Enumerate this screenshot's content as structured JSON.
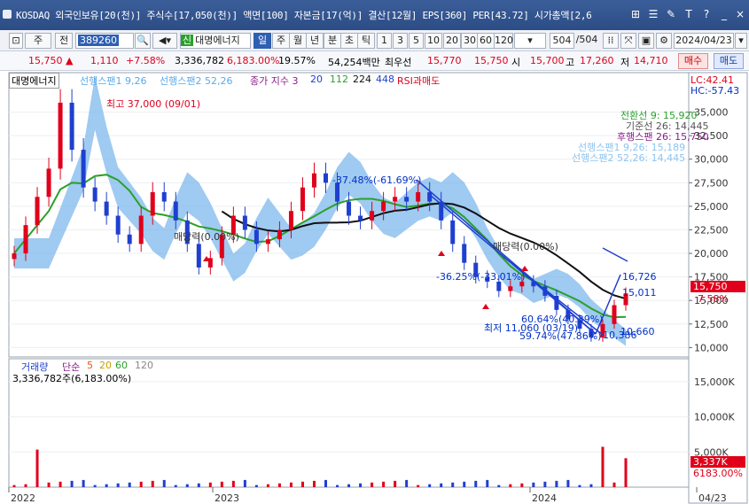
{
  "window": {
    "title": "KOSDAQ 외국인보유[20(천)] 주식수[17,050(천)] 액면[100] 자본금[17(억)] 결산[12월] EPS[360] PER[43.72] 시가총액[2,6",
    "buttons": [
      "⊞",
      "☰",
      "✎",
      "T",
      "?",
      "_",
      "×"
    ]
  },
  "toolbar": {
    "market": "주",
    "prev_label": "전",
    "code": "389260",
    "company": "대명에너지",
    "periods": [
      "일",
      "주",
      "월",
      "년",
      "분",
      "초",
      "틱"
    ],
    "selected_period": "일",
    "intervals": [
      "1",
      "3",
      "5",
      "10",
      "20",
      "30",
      "60",
      "120"
    ],
    "count": "504",
    "total": "/504",
    "date": "2024/04/23"
  },
  "quote": {
    "price": "15,750",
    "change_arrow": "▲",
    "change": "1,110",
    "change_pct": "+7.58%",
    "volume": "3,336,782",
    "volume_pct": "6,183.00%",
    "turnover": "19.57%",
    "amount": "54,254백만",
    "best_sell_label": "최우선",
    "best_sell": "15,770",
    "best_buy": "15,750",
    "open_label": "시",
    "open": "15,700",
    "high_label": "고",
    "high": "17,260",
    "low_label": "저",
    "low": "14,710",
    "buy_label": "매수",
    "sell_label": "매도"
  },
  "legend": {
    "name": "대명에너지",
    "span1": "선행스팬1 9,26",
    "span2": "선행스팬2 52,26",
    "close_index": "종가 지수 3",
    "ma_periods": [
      "20",
      "112",
      "224",
      "448"
    ],
    "rsi": "RSI과매도"
  },
  "ichimoku_labels": [
    "전환선 9: 15,920",
    "기준선 26: 14,445",
    "후행스팬 26: 15,750",
    "선행스팬1 9,26: 15,189",
    "선행스팬2 52,26: 14,445"
  ],
  "right_panel": {
    "lc": "LC:42.41",
    "hc": "HC:-57.43",
    "price_box": "15,750",
    "pct": "7.58%",
    "vol_box": "3,337K",
    "vol_pct": "6183.00%"
  },
  "annotations": {
    "high_note": "최고 37,000 (09/01)",
    "low_note": "최저 11,060 (03/19)",
    "drop1": "-37.48%(-61.69%)",
    "drop2": "-36.25%(-33.01%)",
    "line1": "60.64%(40.39%)",
    "line2": "59.74%(47.86%)",
    "v1": "16,726",
    "v2": "15,011",
    "v3": "10,660",
    "v4": "10,386",
    "bal1": "매당력(0.00%)",
    "bal2": "매당력(0.00%)"
  },
  "volume_panel": {
    "title": "거래량",
    "ma_label": "단순",
    "ma_periods": [
      "5",
      "20",
      "60",
      "120"
    ],
    "current": "3,336,782주(6,183.00%)"
  },
  "chart_data": {
    "type": "line",
    "price_axis": [
      "35,000",
      "32,500",
      "30,000",
      "27,500",
      "25,000",
      "22,500",
      "20,000",
      "17,500",
      "15,000",
      "12,500",
      "10,000"
    ],
    "volume_axis": [
      "15,000K",
      "10,000K",
      "5,000K"
    ],
    "x_labels": [
      "2022",
      "2023",
      "2024",
      "04/23"
    ],
    "ylim": [
      9000,
      37500
    ],
    "close_series": [
      20000,
      23000,
      26000,
      29000,
      36000,
      31000,
      27000,
      25500,
      24000,
      22000,
      21000,
      24000,
      26500,
      25500,
      23500,
      21000,
      18500,
      19500,
      22000,
      24000,
      22500,
      21000,
      21500,
      22500,
      24500,
      27000,
      28500,
      27500,
      25500,
      24000,
      23500,
      24500,
      25500,
      26000,
      25500,
      26500,
      25500,
      23500,
      21000,
      19000,
      17500,
      17000,
      16000,
      16500,
      17000,
      16500,
      15500,
      14000,
      13000,
      12000,
      11060,
      12500,
      14500,
      15750
    ],
    "colors": {
      "up": "#e0001b",
      "down": "#1f3fcf",
      "cloud": "#7fb8ec",
      "ma20": "#2aa02a",
      "ma112": "#111111",
      "ma224": "#2aa02a",
      "trend": "#1f3fcf"
    }
  }
}
